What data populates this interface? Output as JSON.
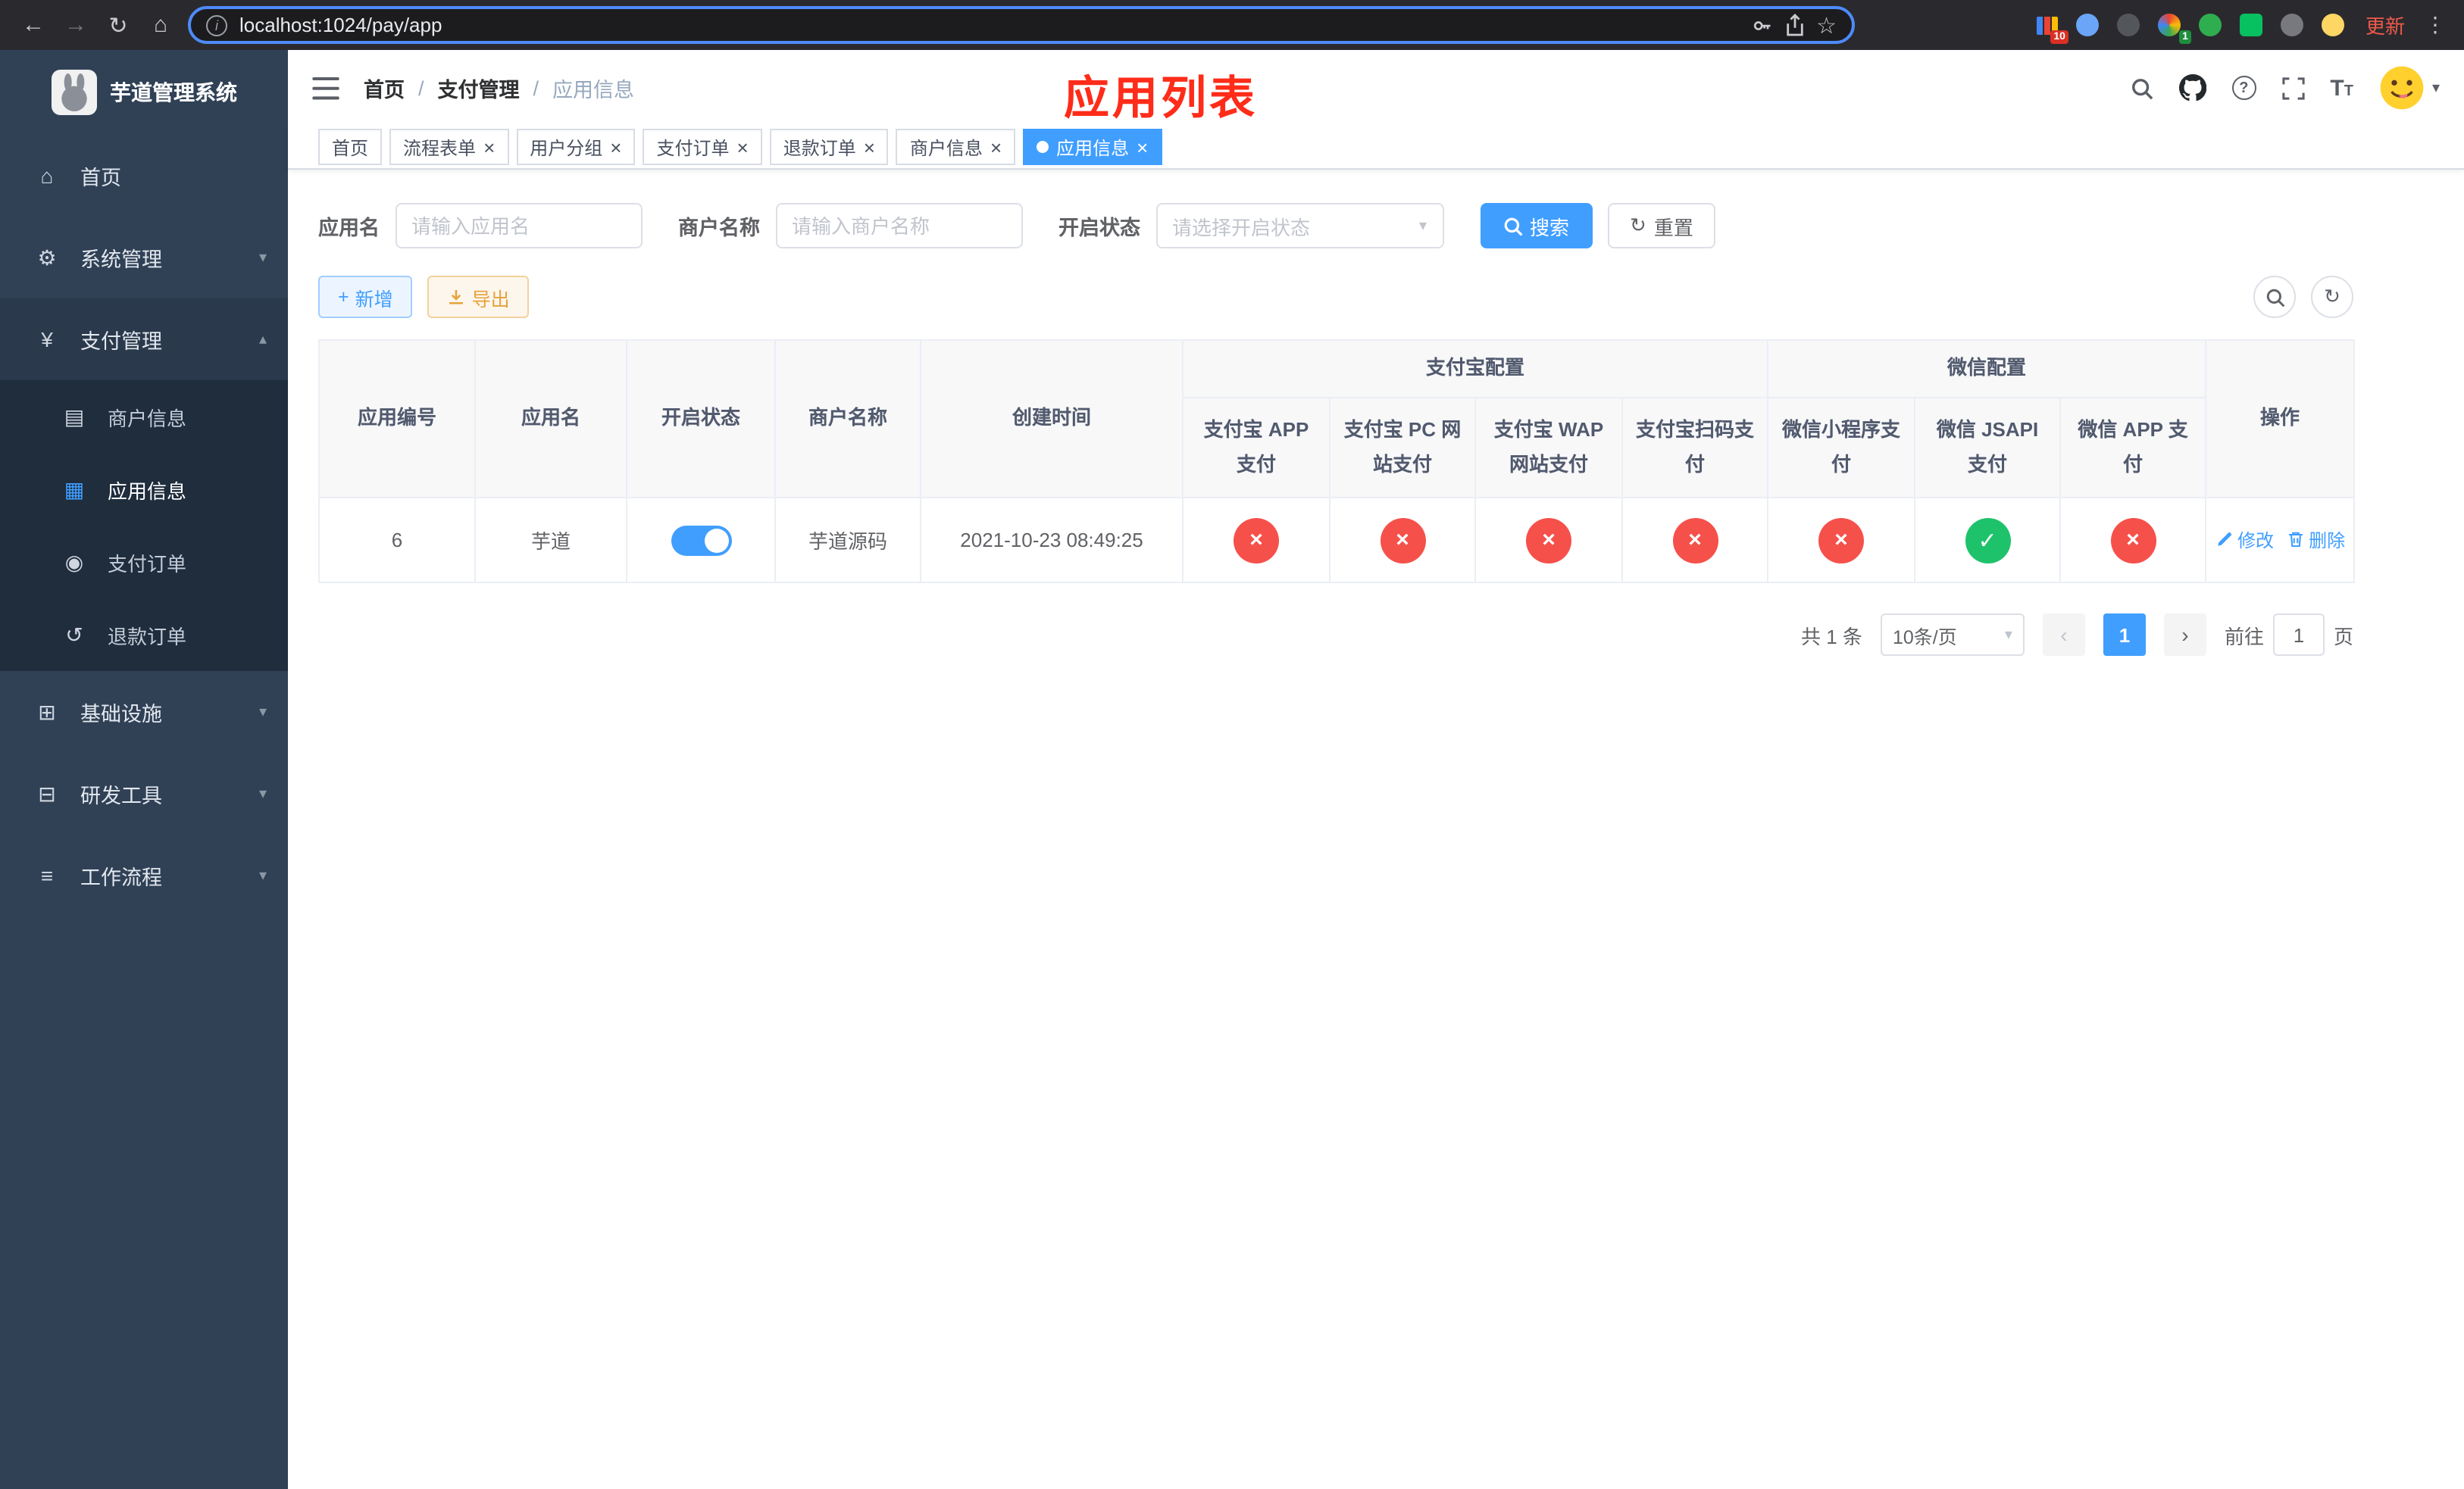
{
  "browser": {
    "url": "localhost:1024/pay/app",
    "update_label": "更新",
    "ext_badge_red": "10",
    "ext_badge_green": "1"
  },
  "icons": {
    "back": "←",
    "forward": "→",
    "reload": "↻",
    "home": "⌂",
    "info": "i",
    "star": "☆",
    "more": "⋮",
    "question": "?",
    "font_size": "T",
    "caret_down": "▾",
    "chevron_down": "▾",
    "chevron_up": "▴",
    "close": "×",
    "plus": "+",
    "refresh": "↻",
    "check": "✓",
    "cross": "×",
    "page_prev": "‹",
    "page_next": "›",
    "nav_home": "⌂",
    "nav_system": "⚙",
    "nav_pay": "¥",
    "nav_merchant": "▤",
    "nav_app": "▦",
    "nav_order": "◉",
    "nav_refund": "↺",
    "nav_infra": "⊞",
    "nav_tools": "⊟",
    "nav_flow": "≡"
  },
  "sidebar": {
    "logo_title": "芋道管理系统",
    "items": [
      {
        "label": "首页"
      },
      {
        "label": "系统管理"
      },
      {
        "label": "支付管理"
      },
      {
        "label": "基础设施"
      },
      {
        "label": "研发工具"
      },
      {
        "label": "工作流程"
      }
    ],
    "submenu": [
      {
        "label": "商户信息"
      },
      {
        "label": "应用信息"
      },
      {
        "label": "支付订单"
      },
      {
        "label": "退款订单"
      }
    ]
  },
  "header": {
    "breadcrumb": [
      "首页",
      "支付管理",
      "应用信息"
    ],
    "separator": "/",
    "annotation": "应用列表"
  },
  "tabs": [
    {
      "label": "首页"
    },
    {
      "label": "流程表单"
    },
    {
      "label": "用户分组"
    },
    {
      "label": "支付订单"
    },
    {
      "label": "退款订单"
    },
    {
      "label": "商户信息"
    },
    {
      "label": "应用信息"
    }
  ],
  "filters": {
    "app_name_label": "应用名",
    "app_name_placeholder": "请输入应用名",
    "merchant_label": "商户名称",
    "merchant_placeholder": "请输入商户名称",
    "status_label": "开启状态",
    "status_placeholder": "请选择开启状态",
    "search_label": "搜索",
    "reset_label": "重置"
  },
  "toolbar": {
    "add_label": "新增",
    "export_label": "导出"
  },
  "table": {
    "plain_headers": [
      "应用编号",
      "应用名",
      "开启状态",
      "商户名称",
      "创建时间"
    ],
    "groups": [
      {
        "label": "支付宝配置",
        "children": [
          "支付宝 APP 支付",
          "支付宝 PC 网站支付",
          "支付宝 WAP 网站支付",
          "支付宝扫码支付"
        ]
      },
      {
        "label": "微信配置",
        "children": [
          "微信小程序支付",
          "微信 JSAPI 支付",
          "微信 APP 支付"
        ]
      }
    ],
    "action_header": "操作",
    "rows": [
      {
        "id": "6",
        "name": "芋道",
        "enabled": true,
        "merchant": "芋道源码",
        "created_at": "2021-10-23 08:49:25",
        "configs": [
          false,
          false,
          false,
          false,
          false,
          true,
          false
        ],
        "edit_label": "修改",
        "delete_label": "删除"
      }
    ]
  },
  "pagination": {
    "total_label": "共 1 条",
    "page_size_label": "10条/页",
    "current_page": "1",
    "goto_label": "前往",
    "goto_value": "1",
    "goto_suffix": "页"
  },
  "colors": {
    "primary": "#409EFF",
    "success": "#1ec26a",
    "danger": "#f6504b",
    "warning": "#e6a23c",
    "annotation_red": "#fe2c19"
  }
}
